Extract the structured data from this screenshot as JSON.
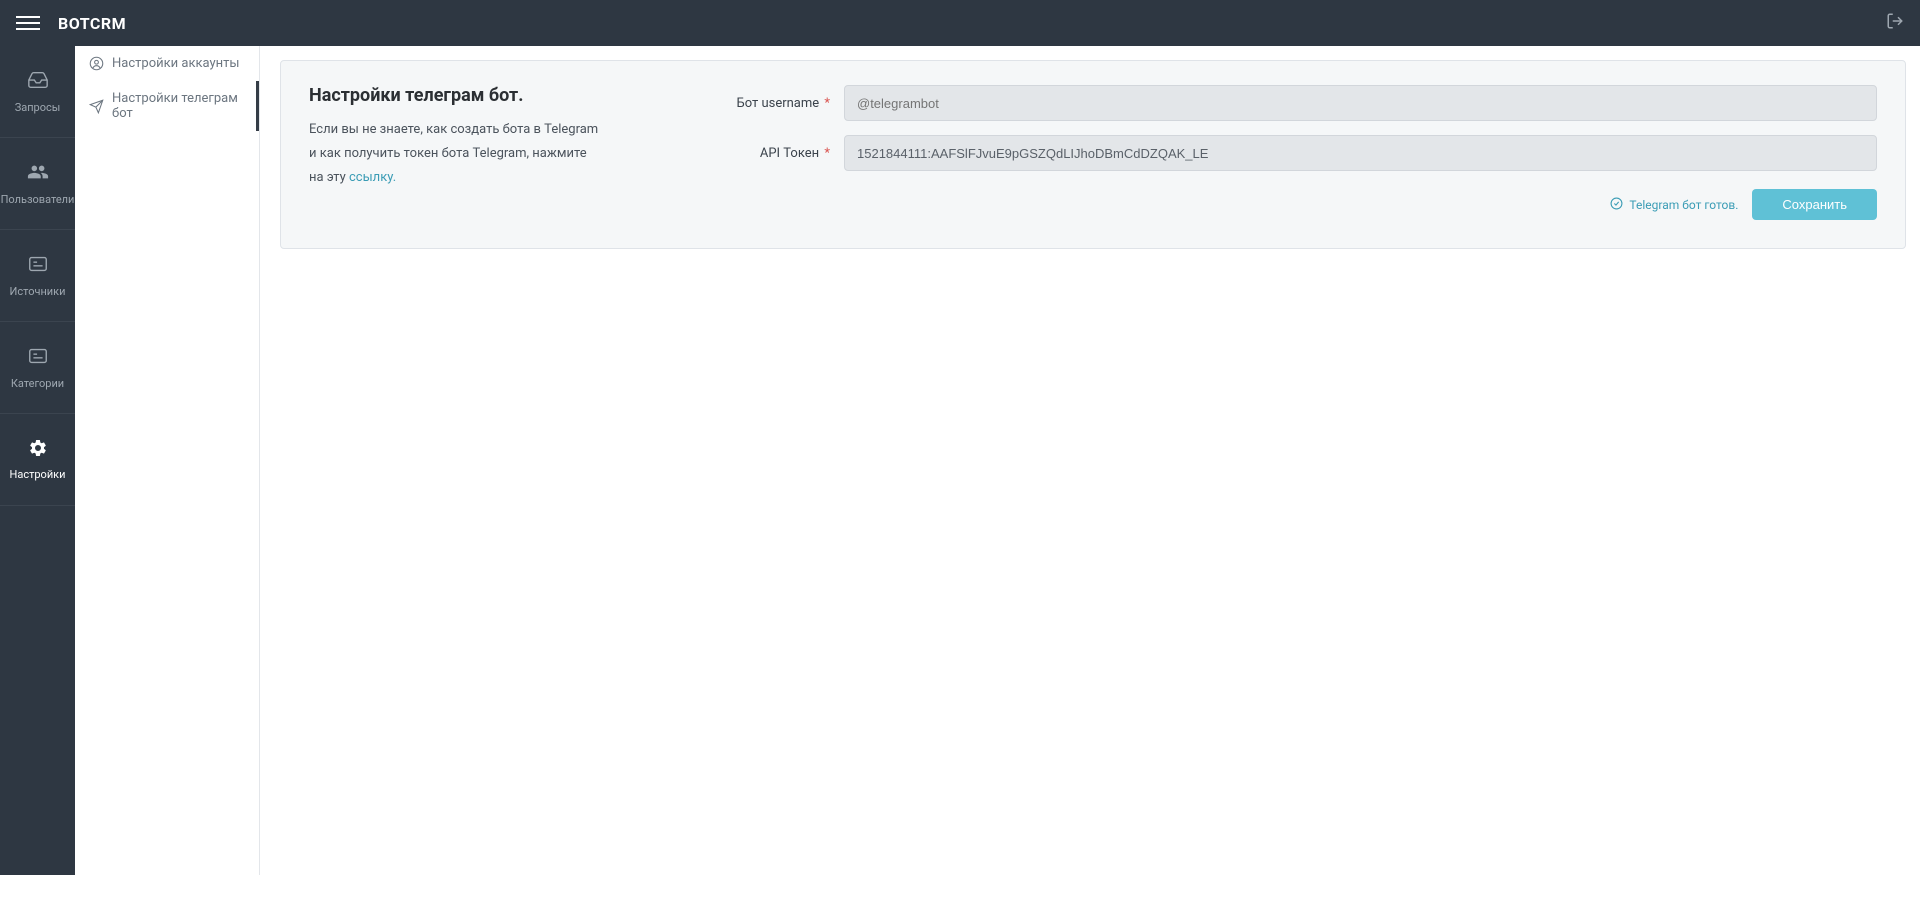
{
  "header": {
    "logo": "BOTCRM"
  },
  "sidebar": {
    "items": [
      {
        "label": "Запросы"
      },
      {
        "label": "Пользователи"
      },
      {
        "label": "Источники"
      },
      {
        "label": "Категории"
      },
      {
        "label": "Настройки"
      }
    ]
  },
  "subsidebar": {
    "items": [
      {
        "label": "Настройки аккаунты"
      },
      {
        "label": "Настройки телеграм бот"
      }
    ]
  },
  "card": {
    "title": "Настройки телеграм бот.",
    "description_part1": "Если вы не знаете, как создать бота в Telegram и как получить токен бота Telegram, нажмите на эту ",
    "link_text": "ссылку.",
    "fields": {
      "username": {
        "label": "Бот username",
        "placeholder": "@telegrambot",
        "value": ""
      },
      "token": {
        "label": "API Токен",
        "value": "1521844111:AAFSlFJvuE9pGSZQdLIJhoDBmCdDZQAK_LE"
      }
    },
    "status": "Telegram бот готов.",
    "save_button": "Сохранить"
  }
}
